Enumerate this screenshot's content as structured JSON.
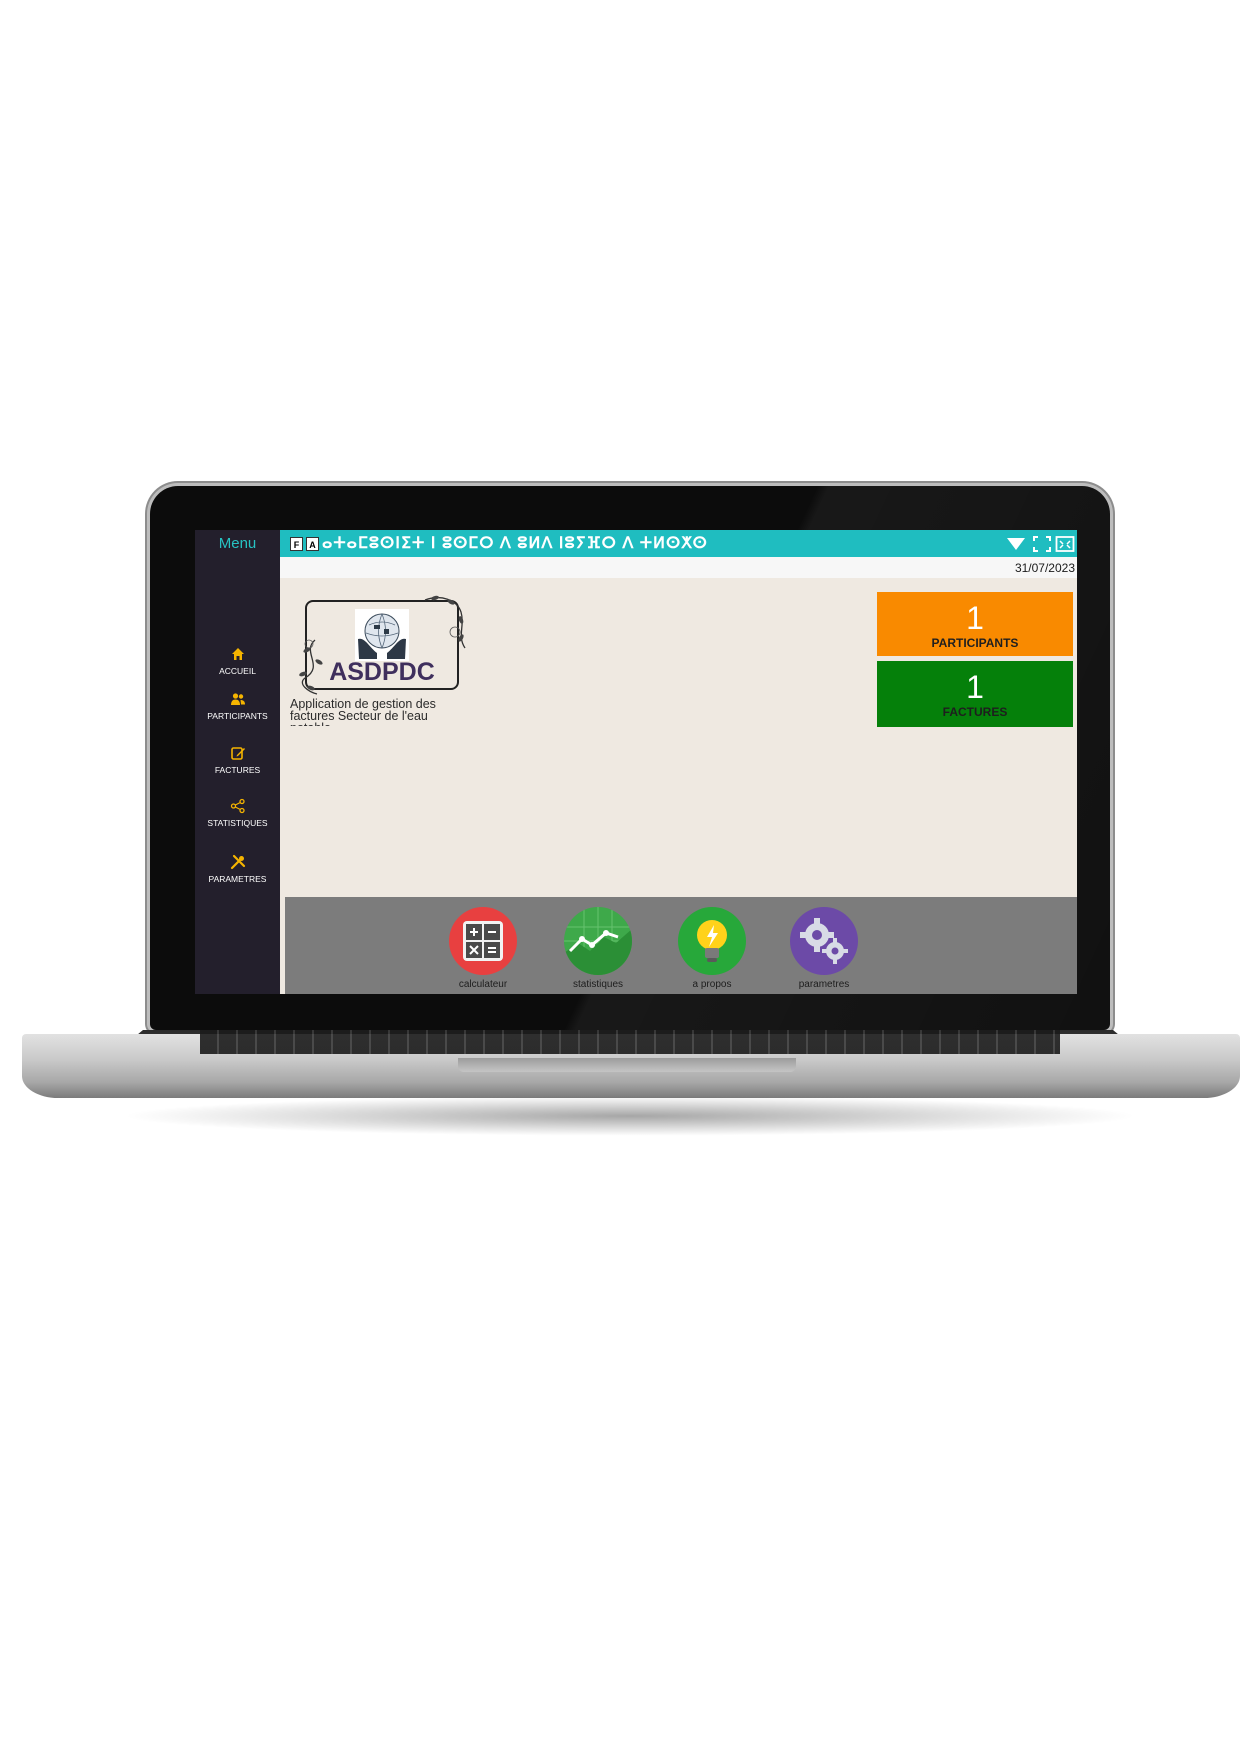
{
  "sidebar": {
    "menu_label": "Menu",
    "items": [
      {
        "label": "ACCUEIL",
        "icon": "home-icon"
      },
      {
        "label": "PARTICIPANTS",
        "icon": "users-icon"
      },
      {
        "label": "FACTURES",
        "icon": "edit-icon"
      },
      {
        "label": "STATISTIQUES",
        "icon": "share-nodes-icon"
      },
      {
        "label": "PARAMETRES",
        "icon": "tools-icon"
      }
    ]
  },
  "topbar": {
    "mini_f": "F",
    "mini_a": "A",
    "title": "ⴰⵜⴰⵎⵓⵙⵏⵉⵜ ⵏ ⵓⵙⵎⵔ ⴷ ⵓⵍⴷ ⵏⵓⵢⴼⵔ ⴷ ⵜⵍⵙⵅⵙ"
  },
  "date": "31/07/2023",
  "logo": {
    "name": "ASDPDC",
    "subtitle": "Application de gestion des factures   Secteur de l'eau potable"
  },
  "cards": {
    "participants": {
      "value": "1",
      "label": "PARTICIPANTS"
    },
    "factures": {
      "value": "1",
      "label": "FACTURES"
    }
  },
  "tiles": [
    {
      "label": "calculateur",
      "icon": "calculator-icon"
    },
    {
      "label": "statistiques",
      "icon": "line-chart-icon"
    },
    {
      "label": "a propos",
      "icon": "lightbulb-icon"
    },
    {
      "label": "parametres",
      "icon": "gears-icon"
    }
  ],
  "colors": {
    "accent": "#1fbdc0",
    "sidebar": "#231f2c",
    "orange": "#f98a00",
    "green": "#05800a",
    "icon_yellow": "#f5b400"
  }
}
